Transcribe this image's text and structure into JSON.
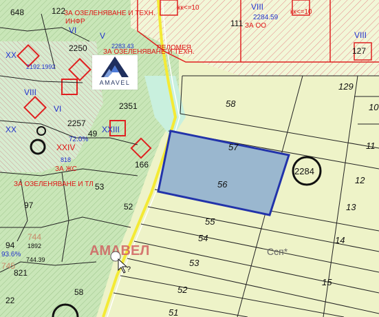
{
  "map": {
    "logo_text": "AMAVEL",
    "watermark": "АМАВЕЛ",
    "zone_label": "Ссп*",
    "selected_parcel": "56",
    "circled_parcel": "2284",
    "parcels_right": [
      {
        "id": "58"
      },
      {
        "id": "57"
      },
      {
        "id": "56"
      },
      {
        "id": "55"
      },
      {
        "id": "54"
      },
      {
        "id": "53"
      },
      {
        "id": "52"
      },
      {
        "id": "51"
      },
      {
        "id": "129"
      },
      {
        "id": "12"
      },
      {
        "id": "13"
      },
      {
        "id": "14"
      },
      {
        "id": "15"
      },
      {
        "id": "11"
      },
      {
        "id": "10"
      }
    ],
    "labels_red": [
      "ЗА ОЗЕЛЕНЯВАНЕ И ТЕХН.",
      "ИНФР",
      "ЗА ОЗЕЛЕНЯВАНЕ И ТЕХН.",
      "РЕЛОМЕЯ",
      "ЗА ОЗЕЛЕНЯВАНЕ И ТЛ",
      "кк<=10",
      "кк<=10",
      "ЗА ОО",
      "ЗА ЖС"
    ],
    "labels_top": [
      "122",
      "VI",
      "V",
      "111",
      "VIII",
      "2284.59",
      "648",
      "2250",
      "2283.43",
      "2192.1992",
      "127",
      "VIII"
    ],
    "labels_left": [
      "XX",
      "VIII",
      "2351",
      "2257",
      "49",
      "XXIII",
      "VI",
      "XXIV",
      "166",
      "818",
      "53",
      "97",
      "52",
      "744",
      "1892",
      "94",
      "744.39",
      "745",
      "821",
      "22",
      "58",
      "93.6%",
      "72.0%",
      "XX"
    ],
    "cursor_symbol": "?"
  }
}
